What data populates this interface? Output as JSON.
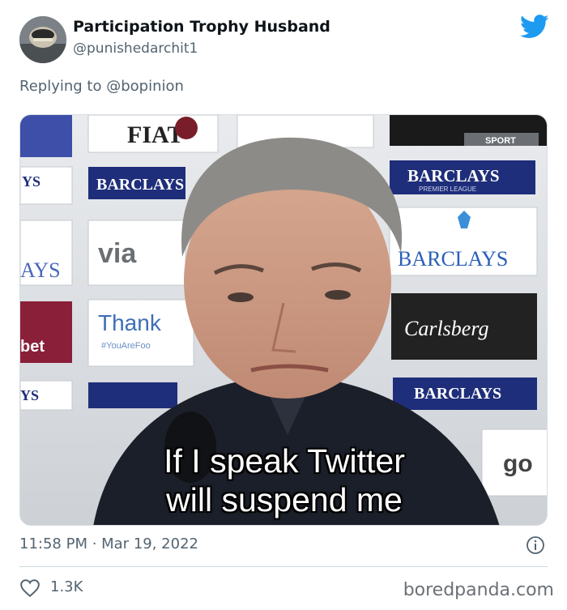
{
  "tweet": {
    "author_name": "Participation Trophy Husband",
    "author_handle": "@punishedarchit1",
    "reply_label": "Replying to @bopinion",
    "timestamp": "11:58 PM · Mar 19, 2022",
    "like_count": "1.3K"
  },
  "image": {
    "meme_line_1": "If I speak Twitter",
    "meme_line_2": "will suspend me",
    "sponsor_text": [
      "BARCLAYS",
      "BARCLAYS",
      "BARCLAYS",
      "BARCLAYS",
      "Carlsberg",
      "via",
      "Thank",
      "FIAT",
      "YS",
      "YS",
      "AYS",
      "bet",
      "go",
      "SPORT",
      "#YouAreFoo",
      "PREMIER LEAGUE"
    ]
  },
  "watermark": "boredpanda.com",
  "icons": {
    "brand": "twitter-bird-icon",
    "info": "info-icon",
    "like": "heart-icon"
  },
  "colors": {
    "twitter_blue": "#1d9bf0",
    "secondary_text": "#536471",
    "divider": "#cfd9de"
  }
}
